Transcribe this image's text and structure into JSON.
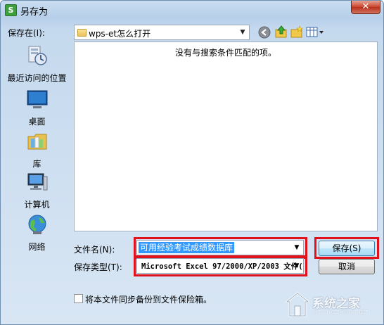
{
  "window": {
    "title": "另存为",
    "app_icon_letter": "S",
    "close_glyph": "✕"
  },
  "location": {
    "label": "保存在(I):",
    "current_folder": "wps-et怎么打开",
    "icons": [
      "back-icon",
      "up-folder-icon",
      "new-folder-icon",
      "view-menu-icon"
    ]
  },
  "places": [
    {
      "name": "recent",
      "label": "最近访问的位置",
      "icon": "recent-places-icon"
    },
    {
      "name": "desktop",
      "label": "桌面",
      "icon": "desktop-icon"
    },
    {
      "name": "library",
      "label": "库",
      "icon": "library-icon"
    },
    {
      "name": "computer",
      "label": "计算机",
      "icon": "computer-icon"
    },
    {
      "name": "network",
      "label": "网络",
      "icon": "network-icon"
    }
  ],
  "file_list": {
    "empty_message": "没有与搜索条件匹配的项。"
  },
  "filename": {
    "label": "文件名(N):",
    "value": "可用经验考试成绩数据库"
  },
  "filetype": {
    "label": "保存类型(T):",
    "value": "Microsoft Excel 97/2000/XP/2003 文件("
  },
  "buttons": {
    "save": "保存(S)",
    "cancel": "取消"
  },
  "backup": {
    "label": "将本文件同步备份到文件保险箱。",
    "checked": false
  },
  "watermark": {
    "text": "系统之家",
    "sub": "XITONGZHIJIA.NET"
  },
  "colors": {
    "highlight_box": "#e0111a",
    "selection": "#3399ff"
  }
}
